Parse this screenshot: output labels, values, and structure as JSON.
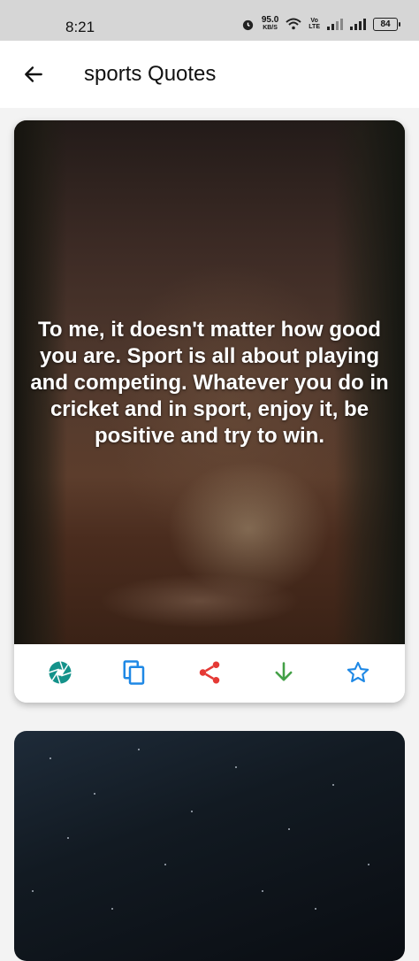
{
  "status_bar": {
    "time": "8:21",
    "net_speed": "95.0",
    "net_unit": "KB/S",
    "volte_top": "Vo",
    "volte_bottom": "LTE",
    "battery": "84"
  },
  "app_bar": {
    "back_icon": "arrow-left-icon",
    "title": "sports Quotes"
  },
  "quote_card": {
    "quote": "To me, it doesn't matter how good you are. Sport is all about playing and competing. Whatever you do in cricket and in sport, enjoy it, be positive and try to win.",
    "actions": [
      {
        "name": "camera-shutter-icon",
        "color": "#14928a"
      },
      {
        "name": "copy-icon",
        "color": "#1e88e5"
      },
      {
        "name": "share-icon",
        "color": "#e53935"
      },
      {
        "name": "download-icon",
        "color": "#43a047"
      },
      {
        "name": "star-icon",
        "color": "#1e88e5"
      }
    ]
  }
}
